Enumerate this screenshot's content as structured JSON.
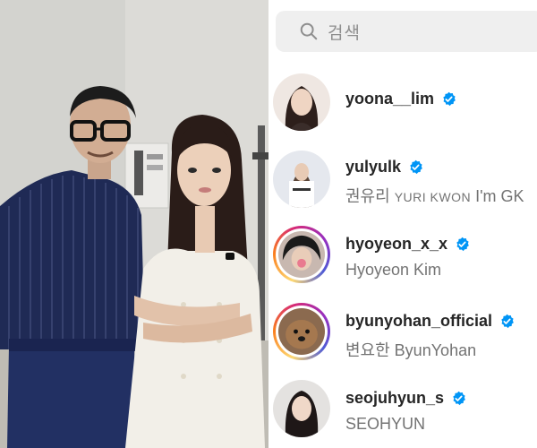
{
  "search": {
    "placeholder": "검색",
    "icon": "search-icon"
  },
  "results": [
    {
      "username": "yoona__lim",
      "fullname": "",
      "verified": true
    },
    {
      "username": "yulyulk",
      "fullname_ko": "권유리",
      "fullname_caps": "YURI KWON",
      "fullname_rest": "I'm GK",
      "verified": true
    },
    {
      "username": "hyoyeon_x_x",
      "fullname": "Hyoyeon Kim",
      "verified": true
    },
    {
      "username": "byunyohan_official",
      "fullname": "변요한 ByunYohan",
      "verified": true
    },
    {
      "username": "seojuhyun_s",
      "fullname": "SEOHYUN",
      "verified": true
    }
  ],
  "colors": {
    "verified_blue": "#0095f6",
    "username": "#262626",
    "secondary": "#737373",
    "search_bg": "#efefef"
  }
}
